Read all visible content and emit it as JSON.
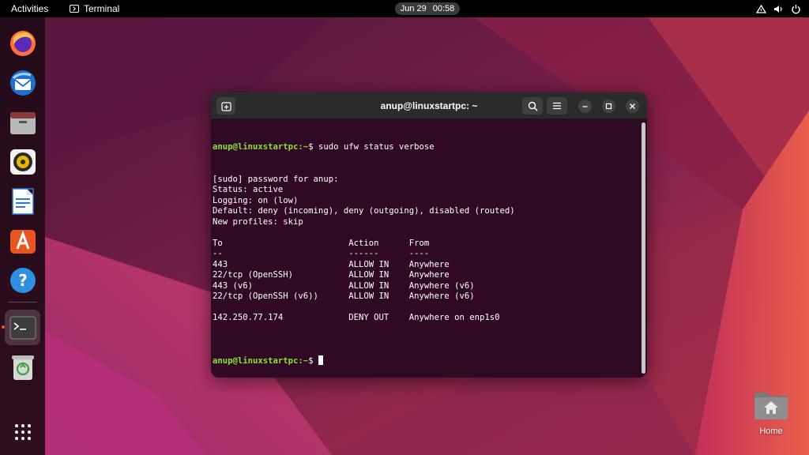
{
  "topbar": {
    "activities": "Activities",
    "app_name": "Terminal",
    "date": "Jun 29",
    "time": "00:58",
    "tray_icons": [
      "network-icon",
      "volume-icon",
      "power-icon"
    ]
  },
  "dock": {
    "apps": [
      {
        "name": "firefox-icon",
        "running": false
      },
      {
        "name": "thunderbird-icon",
        "running": false
      },
      {
        "name": "files-icon",
        "running": false
      },
      {
        "name": "rhythmbox-icon",
        "running": false
      },
      {
        "name": "writer-icon",
        "running": false
      },
      {
        "name": "software-icon",
        "running": false
      },
      {
        "name": "help-icon",
        "running": false
      },
      {
        "name": "terminal-icon",
        "running": true
      },
      {
        "name": "trash-icon",
        "running": false
      },
      {
        "name": "show-apps-icon",
        "running": false
      }
    ]
  },
  "window": {
    "title": "anup@linuxstartpc: ~"
  },
  "terminal": {
    "prompt": "anup@linuxstartpc:~",
    "dollar": "$ ",
    "command": "sudo ufw status verbose",
    "output": [
      "[sudo] password for anup:",
      "Status: active",
      "Logging: on (low)",
      "Default: deny (incoming), deny (outgoing), disabled (routed)",
      "New profiles: skip",
      "",
      "To                         Action      From",
      "--                         ------      ----",
      "443                        ALLOW IN    Anywhere",
      "22/tcp (OpenSSH)           ALLOW IN    Anywhere",
      "443 (v6)                   ALLOW IN    Anywhere (v6)",
      "22/tcp (OpenSSH (v6))      ALLOW IN    Anywhere (v6)",
      "",
      "142.250.77.174             DENY OUT    Anywhere on enp1s0",
      ""
    ]
  },
  "desktop": {
    "home_label": "Home"
  },
  "colors": {
    "terminal_bg": "#300a24",
    "prompt_green": "#8ae234",
    "accent_orange": "#e95420"
  }
}
